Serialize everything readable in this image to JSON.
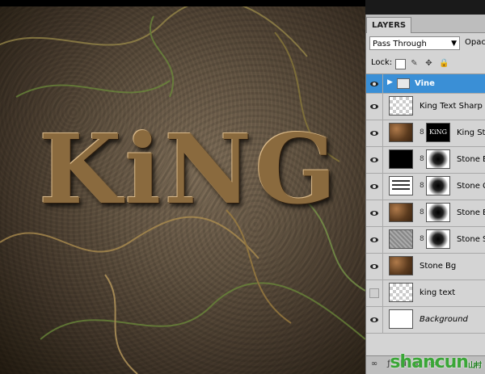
{
  "canvas": {
    "artwork_title": "KiNG"
  },
  "layers_panel": {
    "tab_label": "LAYERS",
    "blend_mode": "Pass Through",
    "opacity_label": "Opaci",
    "lock_label": "Lock:",
    "layers": [
      {
        "name": "Vine",
        "type": "group",
        "visible": true,
        "selected": true
      },
      {
        "name": "King Text Sharp",
        "visible": true,
        "italic": false
      },
      {
        "name": "King Sto",
        "visible": true,
        "italic": false,
        "mask_text": "KiNG"
      },
      {
        "name": "Stone E",
        "visible": true,
        "italic": false
      },
      {
        "name": "Stone C",
        "visible": true,
        "italic": false
      },
      {
        "name": "Stone B",
        "visible": true,
        "italic": false
      },
      {
        "name": "Stone S",
        "visible": true,
        "italic": false
      },
      {
        "name": "Stone Bg",
        "visible": true,
        "italic": false
      },
      {
        "name": "king text",
        "visible": false,
        "italic": false
      },
      {
        "name": "Background",
        "visible": true,
        "italic": true
      }
    ]
  },
  "watermark": {
    "text": "shancun",
    "sub": "山村"
  },
  "colors": {
    "selection": "#3a8fd6",
    "panel_bg": "#d4d4d4",
    "watermark": "#3aa637"
  }
}
